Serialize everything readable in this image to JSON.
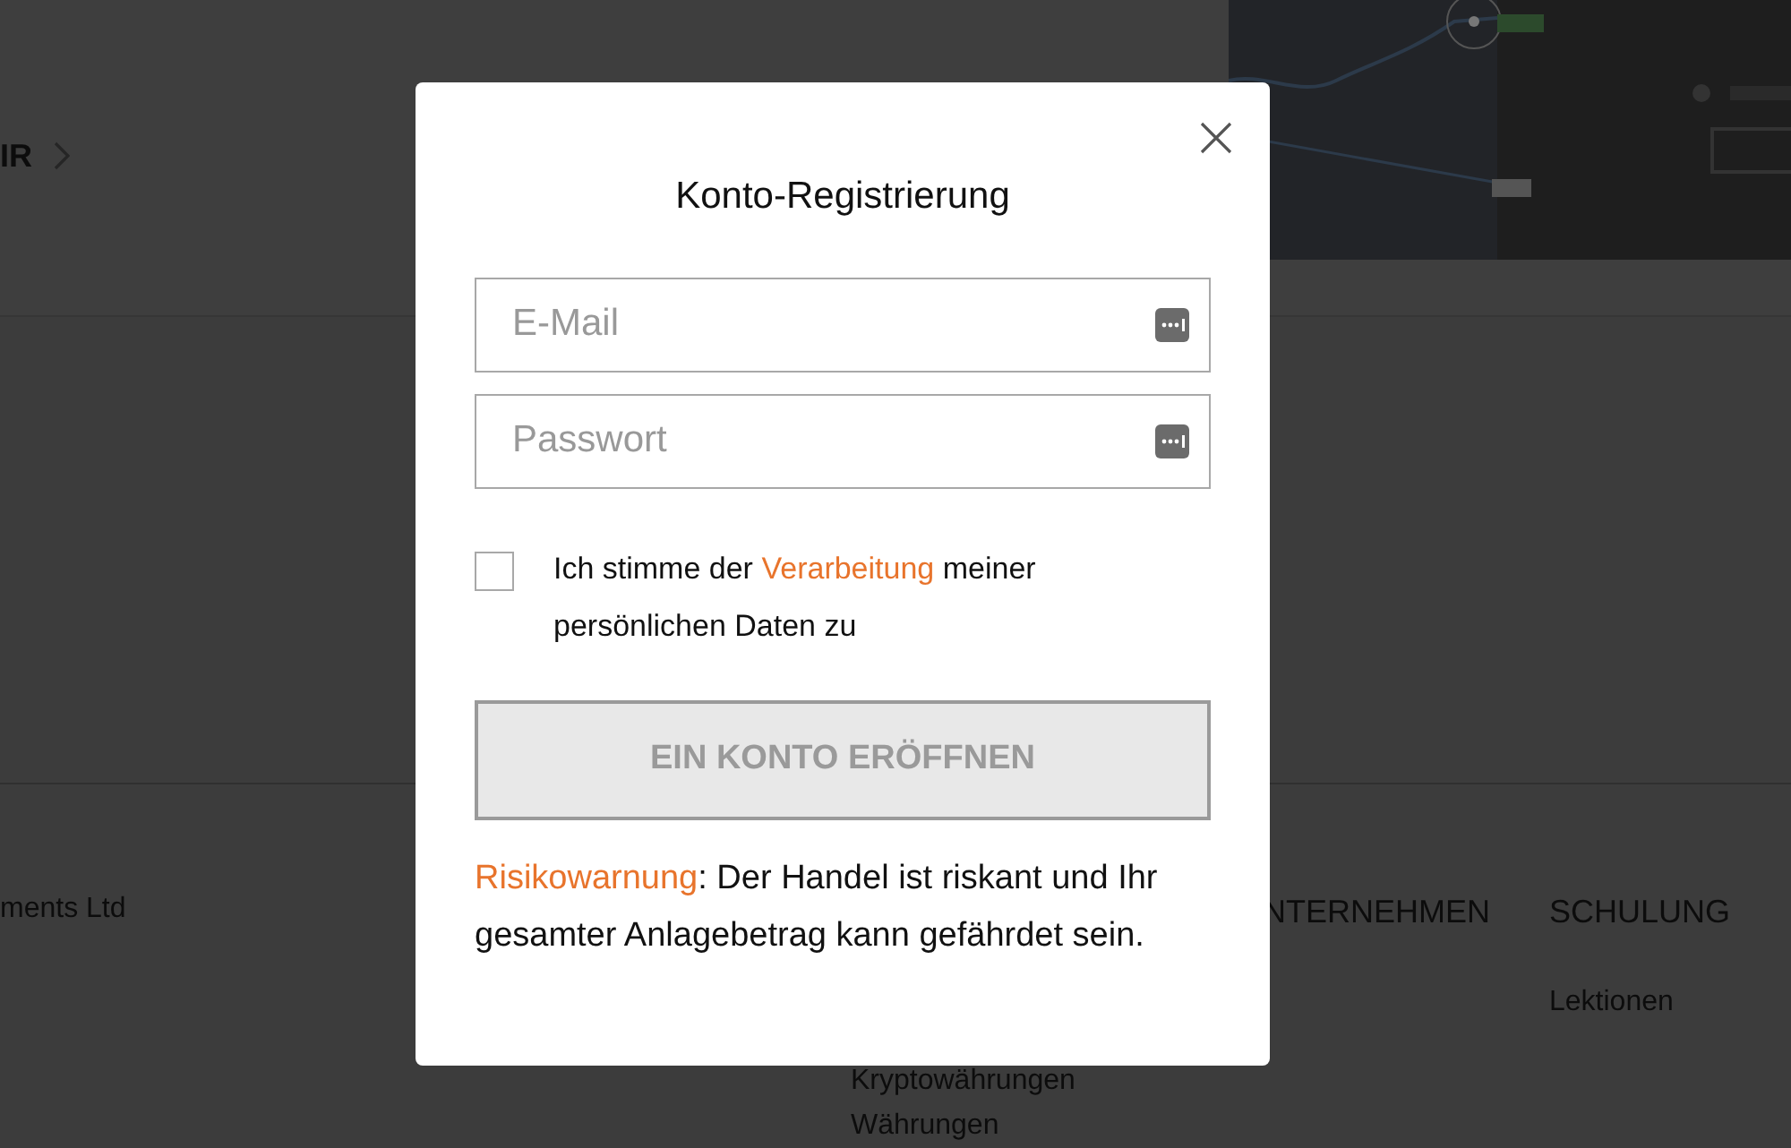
{
  "page": {
    "link": {
      "label": "IR"
    },
    "footer": {
      "company": "ments Ltd",
      "links": [
        "Kryptowährungen",
        "Währungen"
      ],
      "columns": [
        {
          "heading": "NTERNEHMEN"
        },
        {
          "heading": "SCHULUNG",
          "links": [
            "Lektionen"
          ]
        }
      ]
    }
  },
  "modal": {
    "title": "Konto-Registrierung",
    "fields": [
      {
        "placeholder": "E-Mail"
      },
      {
        "placeholder": "Passwort"
      }
    ],
    "consent": {
      "checked": false,
      "before": "Ich stimme der",
      "link": "Verarbeitung",
      "after": "meiner persönlichen Daten zu"
    },
    "submit": {
      "label": "EIN KONTO ERÖFFNEN",
      "disabled": true
    },
    "warning": {
      "link": "Risikowarnung",
      "text": ": Der Handel ist riskant und Ihr gesamter Anlagebetrag kann gefährdet sein."
    }
  }
}
